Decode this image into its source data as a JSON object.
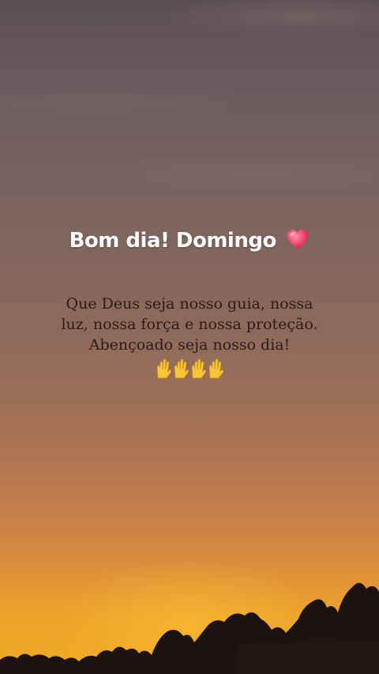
{
  "story": {
    "title": "Bom dia! Domingo",
    "title_emoji": "heart-emoji",
    "message_lines": [
      "Que Deus seja nosso guia, nossa",
      "luz, nossa força e nossa proteção.",
      "Abençoado seja nosso dia!"
    ],
    "closing_emoji": [
      "raising-hands-emoji",
      "raising-hands-emoji",
      "raising-hands-emoji",
      "raising-hands-emoji"
    ]
  },
  "colors": {
    "sky_top": "#5a4e52",
    "sky_bottom": "#f2aa22",
    "title_text": "#ffffff",
    "message_text": "#2a1b17",
    "heart": "#f2456e"
  }
}
